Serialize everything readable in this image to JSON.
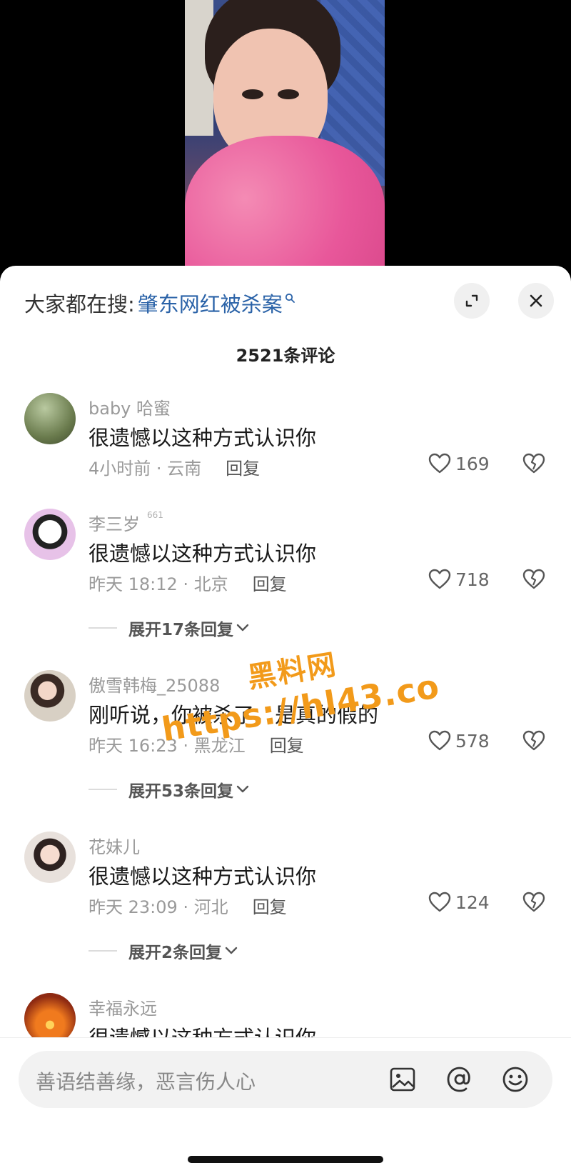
{
  "search": {
    "label": "大家都在搜:",
    "term": "肇东网红被杀案"
  },
  "sheet": {
    "title": "2521条评论"
  },
  "comments": [
    {
      "user": "baby 哈蜜",
      "badge": "",
      "text": "很遗憾以这种方式认识你",
      "meta": "4小时前 · 云南",
      "reply": "回复",
      "likes": "169"
    },
    {
      "user": "李三岁",
      "badge": "661",
      "text": "很遗憾以这种方式认识你",
      "meta": "昨天 18:12 · 北京",
      "reply": "回复",
      "likes": "718",
      "expand": "展开17条回复"
    },
    {
      "user": "傲雪韩梅_25088",
      "badge": "",
      "text": "刚听说，你被杀了，是真的假的",
      "meta": "昨天 16:23 · 黑龙江",
      "reply": "回复",
      "likes": "578",
      "expand": "展开53条回复"
    },
    {
      "user": "花妹儿",
      "badge": "",
      "text": "很遗憾以这种方式认识你",
      "meta": "昨天 23:09 · 河北",
      "reply": "回复",
      "likes": "124",
      "expand": "展开2条回复"
    },
    {
      "user": "幸福永远",
      "badge": "",
      "text": "很遗憾以这种方式认识你",
      "meta": "",
      "reply": "",
      "likes": ""
    }
  ],
  "watermark": {
    "line1": "黑料网",
    "line2": "https://hl43.co"
  },
  "input": {
    "placeholder": "善语结善缘，恶言伤人心"
  },
  "icons": {
    "search_term": "search-icon",
    "expand": "expand-icon",
    "close": "close-icon",
    "like": "heart-icon",
    "dislike": "broken-heart-icon",
    "chevron": "chevron-down-icon",
    "image": "image-icon",
    "mention": "at-icon",
    "emoji": "emoji-icon"
  },
  "colors": {
    "link": "#2b63a8",
    "watermark": "#f29a1a",
    "text": "#1a1a1a",
    "muted": "#9a9a9a"
  }
}
